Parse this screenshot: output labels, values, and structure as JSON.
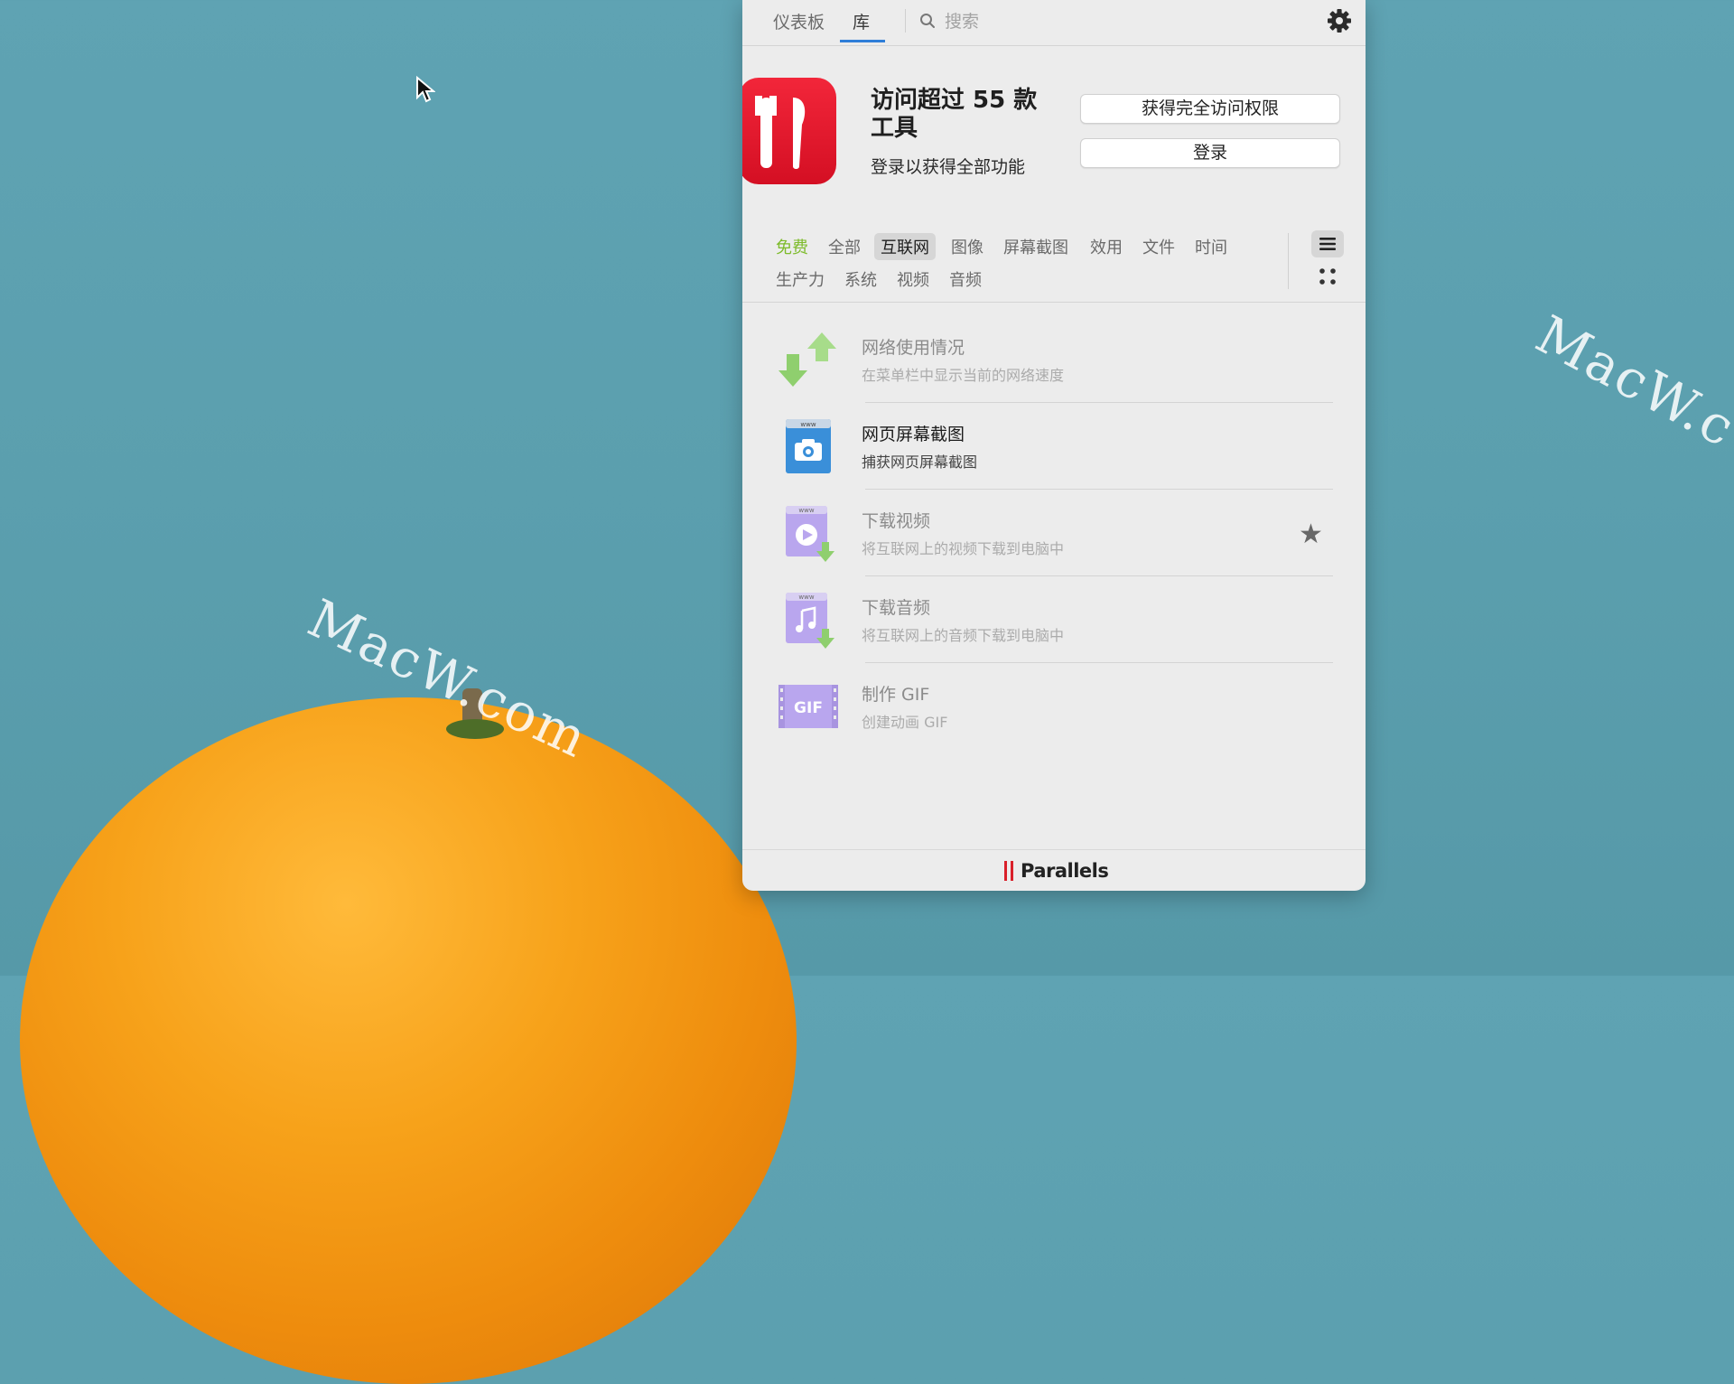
{
  "desktop": {
    "watermarks": [
      "MacW.com",
      "MacW.c"
    ]
  },
  "toolbar": {
    "tab_dashboard": "仪表板",
    "tab_library": "库",
    "search_placeholder": "搜索"
  },
  "promo": {
    "title": "访问超过 55 款工具",
    "subtitle": "登录以获得全部功能",
    "full_access_button": "获得完全访问权限",
    "login_button": "登录",
    "icon_color": "#e8192c"
  },
  "categories": {
    "row1": [
      "免费",
      "全部",
      "互联网",
      "图像",
      "屏幕截图",
      "效用",
      "文件",
      "时间"
    ],
    "row2": [
      "生产力",
      "系统",
      "视频",
      "音频"
    ],
    "active": "互联网",
    "free_color": "#7dbb2a"
  },
  "tools": [
    {
      "name": "网络使用情况",
      "desc": "在菜单栏中显示当前的网络速度",
      "icon": "network-arrows-icon",
      "enabled": false,
      "starred": false
    },
    {
      "name": "网页屏幕截图",
      "desc": "捕获网页屏幕截图",
      "icon": "web-screenshot-icon",
      "enabled": true,
      "starred": false
    },
    {
      "name": "下载视频",
      "desc": "将互联网上的视频下载到电脑中",
      "icon": "download-video-icon",
      "enabled": false,
      "starred": true
    },
    {
      "name": "下载音频",
      "desc": "将互联网上的音频下载到电脑中",
      "icon": "download-audio-icon",
      "enabled": false,
      "starred": false
    },
    {
      "name": "制作 GIF",
      "desc": "创建动画 GIF",
      "icon": "make-gif-icon",
      "enabled": false,
      "starred": false
    }
  ],
  "footer": {
    "brand": "Parallels",
    "brand_color": "#d9202a"
  }
}
